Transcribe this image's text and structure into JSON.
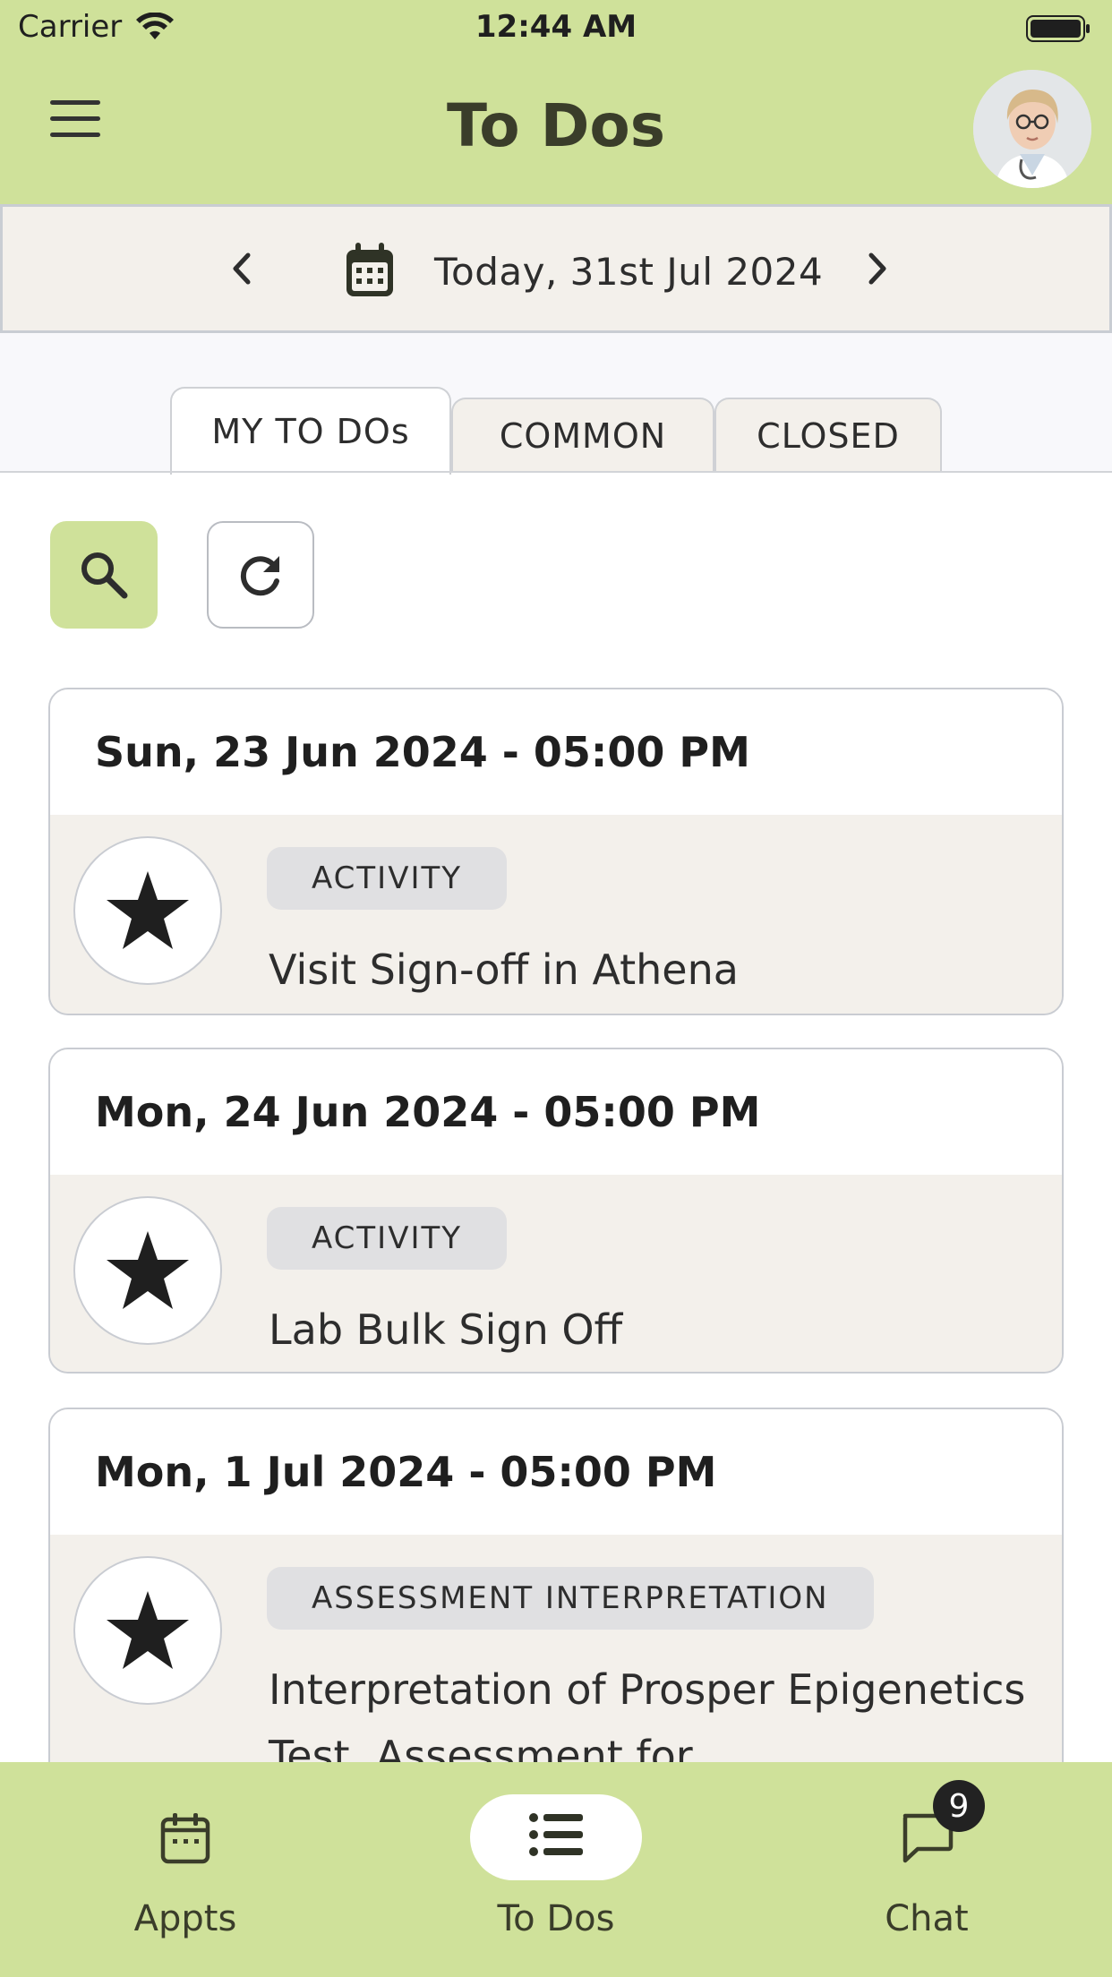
{
  "status_bar": {
    "carrier": "Carrier",
    "time": "12:44 AM"
  },
  "header": {
    "title": "To Dos"
  },
  "date_nav": {
    "date_label": "Today, 31st Jul 2024"
  },
  "tabs": [
    {
      "label": "MY TO DOs",
      "active": true
    },
    {
      "label": "COMMON",
      "active": false
    },
    {
      "label": "CLOSED",
      "active": false
    }
  ],
  "colors": {
    "accent": "#cfe19a",
    "card_body": "#f3f0eb",
    "badge": "#e0e0e2"
  },
  "todos": [
    {
      "datetime": "Sun, 23 Jun 2024 - 05:00 PM",
      "category": "ACTIVITY",
      "title": "Visit Sign-off in Athena"
    },
    {
      "datetime": "Mon, 24 Jun 2024 - 05:00 PM",
      "category": "ACTIVITY",
      "title": "Lab Bulk Sign Off"
    },
    {
      "datetime": "Mon, 1 Jul 2024 - 05:00 PM",
      "category": "ASSESSMENT INTERPRETATION",
      "title": "Interpretation of Prosper Epigenetics Test, Assessment for"
    }
  ],
  "bottom_nav": {
    "items": [
      {
        "label": "Appts",
        "icon": "calendar-icon"
      },
      {
        "label": "To Dos",
        "icon": "list-icon",
        "active": true
      },
      {
        "label": "Chat",
        "icon": "chat-icon"
      }
    ],
    "chat_badge": "9"
  }
}
